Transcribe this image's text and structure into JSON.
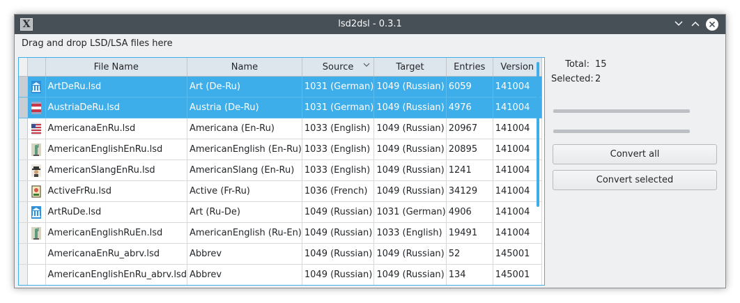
{
  "window": {
    "title": "lsd2dsl - 0.3.1",
    "hint": "Drag and drop LSD/LSA files here"
  },
  "table": {
    "columns": [
      "File Name",
      "Name",
      "Source",
      "Target",
      "Entries",
      "Version"
    ],
    "sorted_column": "Source",
    "rows": [
      {
        "icon": "museum-icon",
        "file": "ArtDeRu.lsd",
        "name": "Art (De-Ru)",
        "source": "1031 (German)",
        "target": "1049 (Russian)",
        "entries": "6059",
        "version": "141004",
        "selected": true
      },
      {
        "icon": "austria-flag-icon",
        "file": "AustriaDeRu.lsd",
        "name": "Austria (De-Ru)",
        "source": "1031 (German)",
        "target": "1049 (Russian)",
        "entries": "4976",
        "version": "141004",
        "selected": true
      },
      {
        "icon": "usa-flag-icon",
        "file": "AmericanaEnRu.lsd",
        "name": "Americana (En-Ru)",
        "source": "1033 (English)",
        "target": "1049 (Russian)",
        "entries": "20967",
        "version": "141004",
        "selected": false
      },
      {
        "icon": "statue-of-liberty-icon",
        "file": "AmericanEnglishEnRu.lsd",
        "name": "AmericanEnglish (En-Ru)",
        "source": "1033 (English)",
        "target": "1049 (Russian)",
        "entries": "20895",
        "version": "141004",
        "selected": false
      },
      {
        "icon": "hat-man-icon",
        "file": "AmericanSlangEnRu.lsd",
        "name": "AmericanSlang (En-Ru)",
        "source": "1033 (English)",
        "target": "1049 (Russian)",
        "entries": "1241",
        "version": "141004",
        "selected": false
      },
      {
        "icon": "book-icon",
        "file": "ActiveFrRu.lsd",
        "name": "Active (Fr-Ru)",
        "source": "1036 (French)",
        "target": "1049 (Russian)",
        "entries": "34129",
        "version": "141004",
        "selected": false
      },
      {
        "icon": "museum-icon",
        "file": "ArtRuDe.lsd",
        "name": "Art (Ru-De)",
        "source": "1049 (Russian)",
        "target": "1031 (German)",
        "entries": "4906",
        "version": "141004",
        "selected": false
      },
      {
        "icon": "statue-of-liberty-icon",
        "file": "AmericanEnglishRuEn.lsd",
        "name": "AmericanEnglish (Ru-En)",
        "source": "1049 (Russian)",
        "target": "1033 (English)",
        "entries": "19491",
        "version": "141004",
        "selected": false
      },
      {
        "icon": "",
        "file": "AmericanaEnRu_abrv.lsd",
        "name": "Abbrev",
        "source": "1049 (Russian)",
        "target": "1049 (Russian)",
        "entries": "52",
        "version": "145001",
        "selected": false
      },
      {
        "icon": "",
        "file": "AmericanEnglishEnRu_abrv.lsd",
        "name": "Abbrev",
        "source": "1049 (Russian)",
        "target": "1049 (Russian)",
        "entries": "134",
        "version": "145001",
        "selected": false
      }
    ]
  },
  "stats": {
    "total_label": "Total:",
    "total_value": "15",
    "selected_label": "Selected:",
    "selected_value": "2"
  },
  "progress": [
    0,
    0
  ],
  "buttons": {
    "convert_all": "Convert all",
    "convert_selected": "Convert selected"
  },
  "colors": {
    "selection": "#3daee9",
    "titlebar": "#475057",
    "header": "#dde6ed"
  }
}
